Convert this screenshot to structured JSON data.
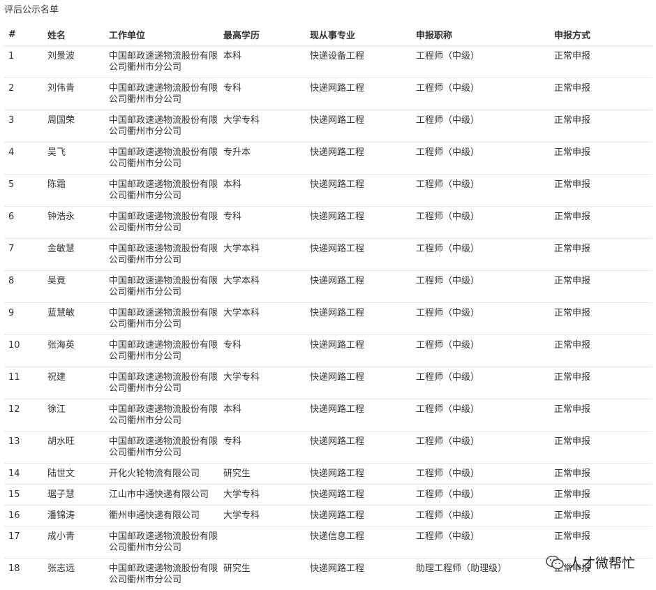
{
  "title": "评后公示名单",
  "headers": [
    "#",
    "姓名",
    "工作单位",
    "最高学历",
    "现从事专业",
    "申报职称",
    "申报方式"
  ],
  "rows": [
    {
      "n": "1",
      "name": "刘景波",
      "org": "中国邮政速递物流股份有限公司衢州市分公司",
      "edu": "本科",
      "major": "快递设备工程",
      "title": "工程师（中级）",
      "mode": "正常申报"
    },
    {
      "n": "2",
      "name": "刘伟青",
      "org": "中国邮政速递物流股份有限公司衢州市分公司",
      "edu": "专科",
      "major": "快递网路工程",
      "title": "工程师（中级）",
      "mode": "正常申报"
    },
    {
      "n": "3",
      "name": "周国荣",
      "org": "中国邮政速递物流股份有限公司衢州市分公司",
      "edu": "大学专科",
      "major": "快递网路工程",
      "title": "工程师（中级）",
      "mode": "正常申报"
    },
    {
      "n": "4",
      "name": "吴飞",
      "org": "中国邮政速递物流股份有限公司衢州市分公司",
      "edu": "专升本",
      "major": "快递网路工程",
      "title": "工程师（中级）",
      "mode": "正常申报"
    },
    {
      "n": "5",
      "name": "陈霜",
      "org": "中国邮政速递物流股份有限公司衢州市分公司",
      "edu": "本科",
      "major": "快递网路工程",
      "title": "工程师（中级）",
      "mode": "正常申报"
    },
    {
      "n": "6",
      "name": "钟浩永",
      "org": "中国邮政速递物流股份有限公司衢州市分公司",
      "edu": "专科",
      "major": "快递网路工程",
      "title": "工程师（中级）",
      "mode": "正常申报"
    },
    {
      "n": "7",
      "name": "金敏慧",
      "org": "中国邮政速递物流股份有限公司衢州市分公司",
      "edu": "大学本科",
      "major": "快递网路工程",
      "title": "工程师（中级）",
      "mode": "正常申报"
    },
    {
      "n": "8",
      "name": "吴竟",
      "org": "中国邮政速递物流股份有限公司衢州市分公司",
      "edu": "大学本科",
      "major": "快递网路工程",
      "title": "工程师（中级）",
      "mode": "正常申报"
    },
    {
      "n": "9",
      "name": "蓝慧敏",
      "org": "中国邮政速递物流股份有限公司衢州市分公司",
      "edu": "大学本科",
      "major": "快递网路工程",
      "title": "工程师（中级）",
      "mode": "正常申报"
    },
    {
      "n": "10",
      "name": "张海英",
      "org": "中国邮政速递物流股份有限公司衢州市分公司",
      "edu": "专科",
      "major": "快递网路工程",
      "title": "工程师（中级）",
      "mode": "正常申报"
    },
    {
      "n": "11",
      "name": "祝建",
      "org": "中国邮政速递物流股份有限公司衢州市分公司",
      "edu": "大学专科",
      "major": "快递网路工程",
      "title": "工程师（中级）",
      "mode": "正常申报"
    },
    {
      "n": "12",
      "name": "徐江",
      "org": "中国邮政速递物流股份有限公司衢州市分公司",
      "edu": "本科",
      "major": "快递网路工程",
      "title": "工程师（中级）",
      "mode": "正常申报"
    },
    {
      "n": "13",
      "name": "胡水旺",
      "org": "中国邮政速递物流股份有限公司衢州市分公司",
      "edu": "专科",
      "major": "快递网路工程",
      "title": "工程师（中级）",
      "mode": "正常申报"
    },
    {
      "n": "14",
      "name": "陆世文",
      "org": "开化火轮物流有限公司",
      "edu": "研究生",
      "major": "快递网路工程",
      "title": "工程师（中级）",
      "mode": "正常申报"
    },
    {
      "n": "15",
      "name": "琚子慧",
      "org": "江山市中通快递有限公司",
      "edu": "大学专科",
      "major": "快递网路工程",
      "title": "工程师（中级）",
      "mode": "正常申报"
    },
    {
      "n": "16",
      "name": "潘锦涛",
      "org": "衢州申通快递有限公司",
      "edu": "大学专科",
      "major": "快递网路工程",
      "title": "工程师（中级）",
      "mode": "正常申报"
    },
    {
      "n": "17",
      "name": "成小青",
      "org": "中国邮政速递物流股份有限公司衢州市分公司",
      "edu": "",
      "major": "快递信息工程",
      "title": "工程师（中级）",
      "mode": "正常申报"
    },
    {
      "n": "18",
      "name": "张志远",
      "org": "中国邮政速递物流股份有限公司衢州市分公司",
      "edu": "研究生",
      "major": "快递网路工程",
      "title": "助理工程师（助理级）",
      "mode": "正常申报"
    }
  ],
  "watermark": {
    "text": "人才微帮忙",
    "icon": "wechat-icon"
  }
}
